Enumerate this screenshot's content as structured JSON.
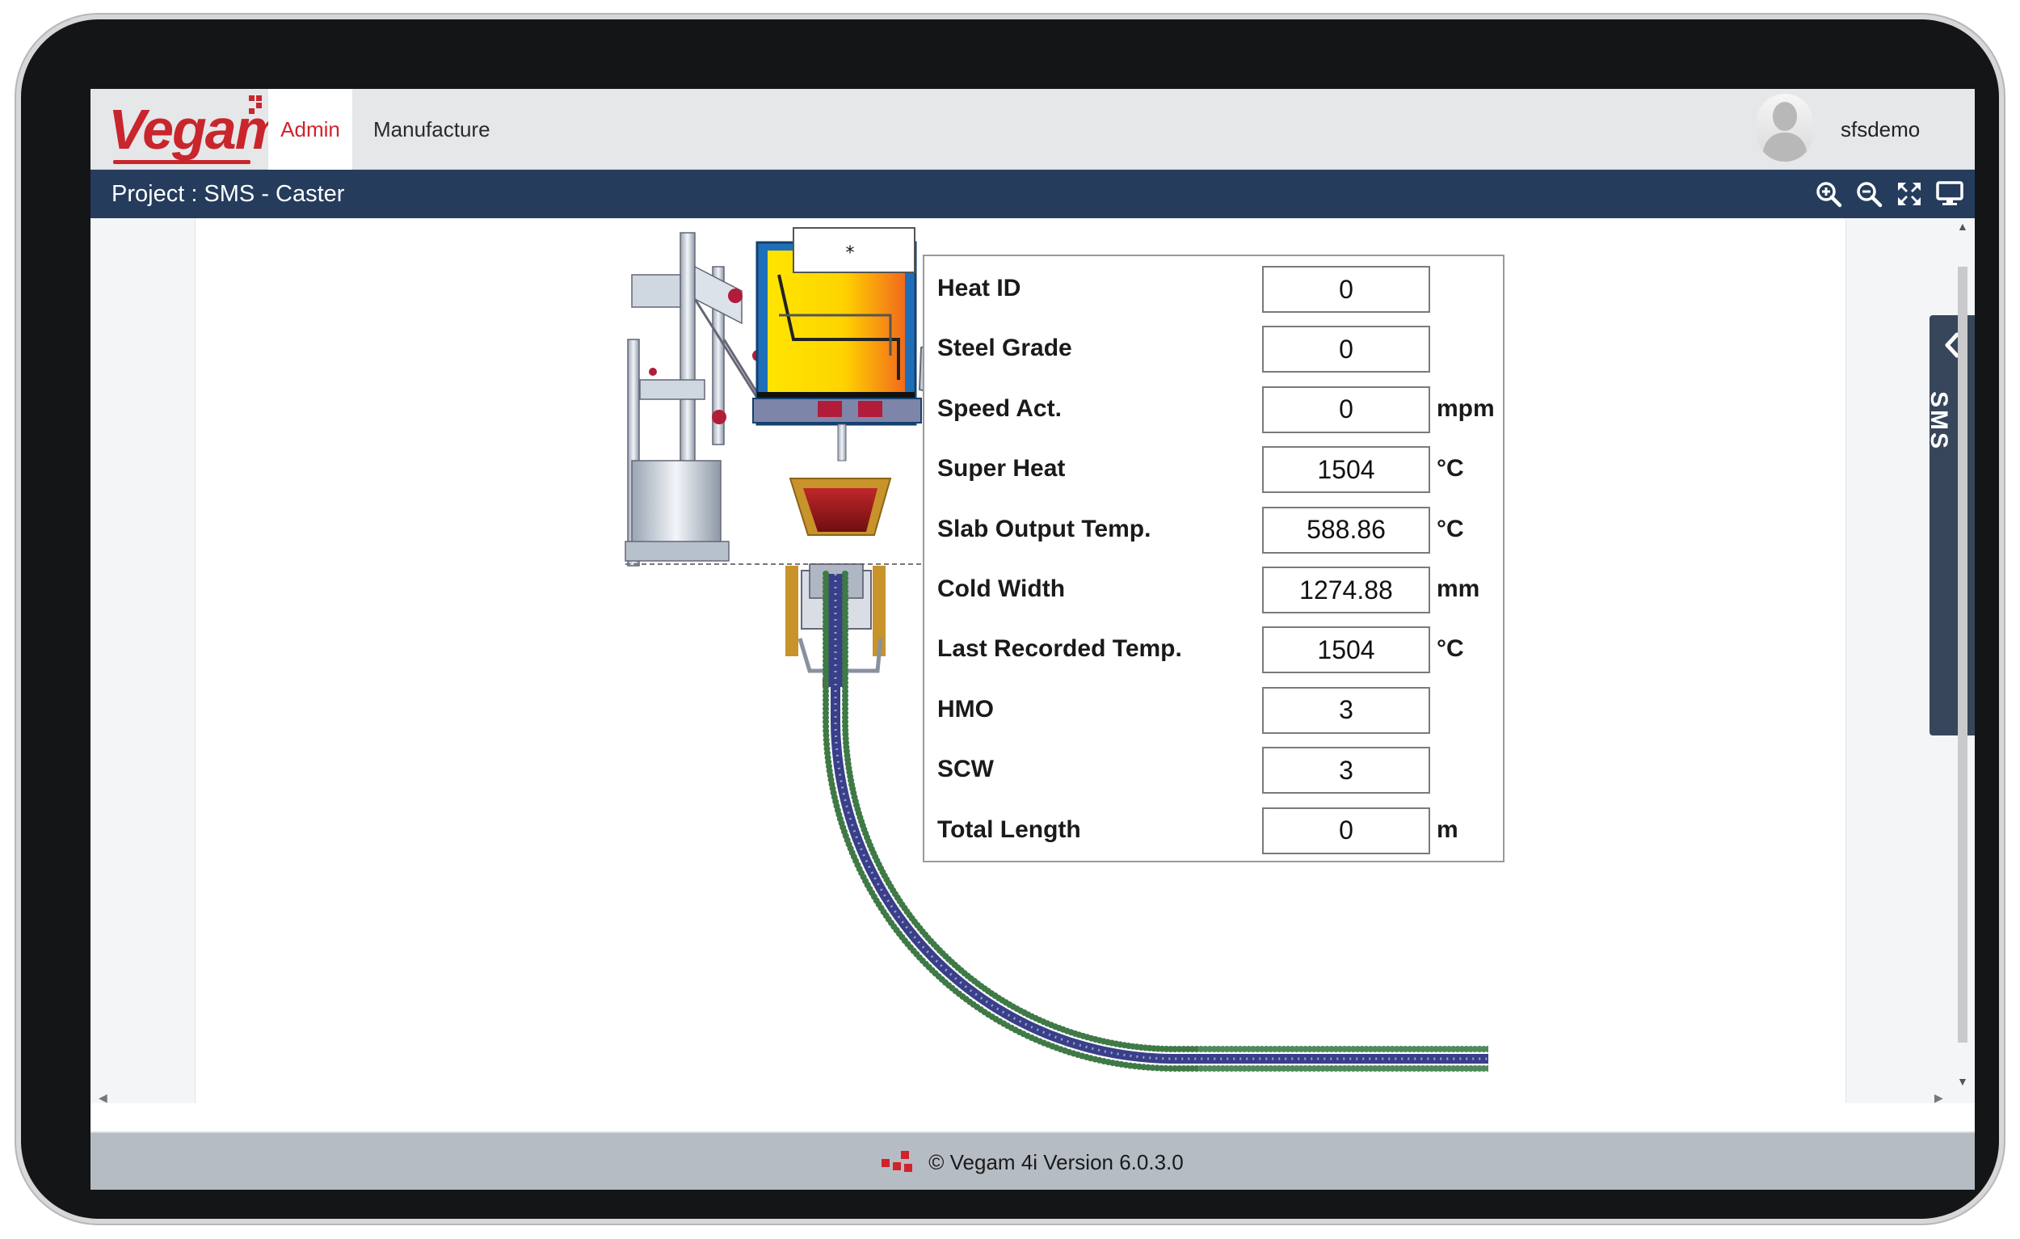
{
  "app": {
    "logo_text": "Vegam",
    "brand_color": "#c8262c",
    "nav": {
      "admin_label": "Admin",
      "manufacture_label": "Manufacture"
    },
    "user": {
      "name": "sfsdemo"
    }
  },
  "project_bar": {
    "title": "Project : SMS - Caster",
    "icons": [
      "zoom-in-icon",
      "zoom-out-icon",
      "fullscreen-icon",
      "monitor-icon"
    ],
    "background": "#253c5c"
  },
  "side_tab": {
    "label": "SMS",
    "icon": "chevron-left-icon"
  },
  "diagram": {
    "tundish_label": "*"
  },
  "parameters": [
    {
      "label": "Heat ID",
      "value": "0",
      "unit": ""
    },
    {
      "label": "Steel Grade",
      "value": "0",
      "unit": ""
    },
    {
      "label": "Speed Act.",
      "value": "0",
      "unit": "mpm"
    },
    {
      "label": "Super Heat",
      "value": "1504",
      "unit": "°C"
    },
    {
      "label": "Slab Output Temp.",
      "value": "588.86",
      "unit": "°C"
    },
    {
      "label": "Cold Width",
      "value": "1274.88",
      "unit": "mm"
    },
    {
      "label": "Last Recorded Temp.",
      "value": "1504",
      "unit": "°C"
    },
    {
      "label": "HMO",
      "value": "3",
      "unit": ""
    },
    {
      "label": "SCW",
      "value": "3",
      "unit": ""
    },
    {
      "label": "Total Length",
      "value": "0",
      "unit": "m"
    }
  ],
  "footer": {
    "text": "© Vegam 4i Version 6.0.3.0"
  }
}
